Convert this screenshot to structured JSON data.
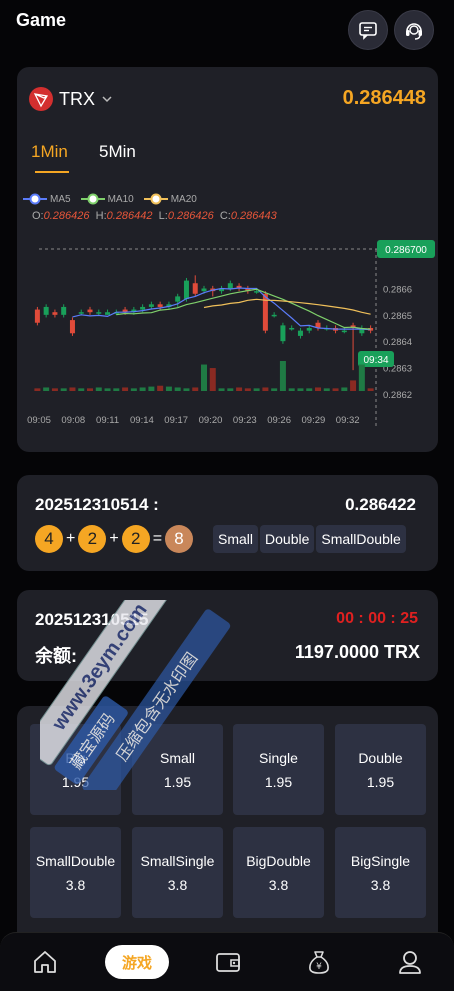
{
  "header": {
    "title": "Game",
    "icons": [
      "message-icon",
      "support-icon"
    ]
  },
  "chart_card": {
    "coin": "TRX",
    "price": "0.286448",
    "tabs": [
      "1Min",
      "5Min"
    ],
    "active_tab": "1Min",
    "legend": [
      "MA5",
      "MA10",
      "MA20"
    ],
    "legend_colors": [
      "#5b7cfa",
      "#7fd06b",
      "#f0c05a"
    ],
    "ohlc": {
      "o_label": "O:",
      "o": "0.286426",
      "h_label": "H:",
      "h": "0.286442",
      "l_label": "L:",
      "l": "0.286426",
      "c_label": "C:",
      "c": "0.286443"
    }
  },
  "chart_data": {
    "type": "candlestick",
    "x_ticks": [
      "09:05",
      "09:08",
      "09:11",
      "09:14",
      "09:17",
      "09:20",
      "09:23",
      "09:26",
      "09:29",
      "09:32"
    ],
    "y_ticks": [
      "0.2866",
      "0.2865",
      "0.2864",
      "0.2863",
      "0.2862"
    ],
    "ylim": [
      0.28615,
      0.28675
    ],
    "max_label": "0.286700",
    "cursor_time": "09:34",
    "candles": [
      {
        "o": 0.28652,
        "c": 0.28647,
        "h": 0.28653,
        "l": 0.28646
      },
      {
        "o": 0.2865,
        "c": 0.28653,
        "h": 0.28654,
        "l": 0.28649
      },
      {
        "o": 0.28651,
        "c": 0.2865,
        "h": 0.28652,
        "l": 0.28649
      },
      {
        "o": 0.2865,
        "c": 0.28653,
        "h": 0.28654,
        "l": 0.28649
      },
      {
        "o": 0.28648,
        "c": 0.28643,
        "h": 0.28649,
        "l": 0.28642
      },
      {
        "o": 0.28651,
        "c": 0.28651,
        "h": 0.28652,
        "l": 0.2865
      },
      {
        "o": 0.28652,
        "c": 0.28651,
        "h": 0.28653,
        "l": 0.2865
      },
      {
        "o": 0.28651,
        "c": 0.28651,
        "h": 0.28652,
        "l": 0.2865
      },
      {
        "o": 0.2865,
        "c": 0.28651,
        "h": 0.28652,
        "l": 0.2865
      },
      {
        "o": 0.28651,
        "c": 0.28651,
        "h": 0.28652,
        "l": 0.2865
      },
      {
        "o": 0.28652,
        "c": 0.28651,
        "h": 0.28653,
        "l": 0.2865
      },
      {
        "o": 0.28651,
        "c": 0.28652,
        "h": 0.28653,
        "l": 0.2865
      },
      {
        "o": 0.28652,
        "c": 0.28653,
        "h": 0.28654,
        "l": 0.28651
      },
      {
        "o": 0.28653,
        "c": 0.28654,
        "h": 0.28655,
        "l": 0.28652
      },
      {
        "o": 0.28654,
        "c": 0.28653,
        "h": 0.28655,
        "l": 0.28652
      },
      {
        "o": 0.28653,
        "c": 0.28654,
        "h": 0.28655,
        "l": 0.28652
      },
      {
        "o": 0.28655,
        "c": 0.28657,
        "h": 0.28658,
        "l": 0.28653
      },
      {
        "o": 0.28656,
        "c": 0.28663,
        "h": 0.28664,
        "l": 0.28655
      },
      {
        "o": 0.28662,
        "c": 0.28658,
        "h": 0.28665,
        "l": 0.28657
      },
      {
        "o": 0.28659,
        "c": 0.2866,
        "h": 0.28661,
        "l": 0.28658
      },
      {
        "o": 0.2866,
        "c": 0.28659,
        "h": 0.28661,
        "l": 0.28657
      },
      {
        "o": 0.28659,
        "c": 0.2866,
        "h": 0.28661,
        "l": 0.28658
      },
      {
        "o": 0.2866,
        "c": 0.28662,
        "h": 0.28663,
        "l": 0.28659
      },
      {
        "o": 0.28661,
        "c": 0.2866,
        "h": 0.28662,
        "l": 0.28659
      },
      {
        "o": 0.2866,
        "c": 0.28659,
        "h": 0.28661,
        "l": 0.28658
      },
      {
        "o": 0.28659,
        "c": 0.28659,
        "h": 0.2866,
        "l": 0.28658
      },
      {
        "o": 0.28658,
        "c": 0.28644,
        "h": 0.28659,
        "l": 0.28643
      },
      {
        "o": 0.2865,
        "c": 0.2865,
        "h": 0.28651,
        "l": 0.28649
      },
      {
        "o": 0.2864,
        "c": 0.28646,
        "h": 0.28647,
        "l": 0.28639
      },
      {
        "o": 0.28645,
        "c": 0.28645,
        "h": 0.28646,
        "l": 0.28644
      },
      {
        "o": 0.28642,
        "c": 0.28644,
        "h": 0.28645,
        "l": 0.28641
      },
      {
        "o": 0.28644,
        "c": 0.28645,
        "h": 0.28646,
        "l": 0.28643
      },
      {
        "o": 0.28647,
        "c": 0.28645,
        "h": 0.28648,
        "l": 0.28644
      },
      {
        "o": 0.28645,
        "c": 0.28645,
        "h": 0.28646,
        "l": 0.28644
      },
      {
        "o": 0.28645,
        "c": 0.28644,
        "h": 0.28646,
        "l": 0.28643
      },
      {
        "o": 0.28644,
        "c": 0.28644,
        "h": 0.28645,
        "l": 0.28643
      },
      {
        "o": 0.28646,
        "c": 0.28645,
        "h": 0.28647,
        "l": 0.28629
      },
      {
        "o": 0.28643,
        "c": 0.28645,
        "h": 0.28646,
        "l": 0.28642
      },
      {
        "o": 0.28645,
        "c": 0.28644,
        "h": 0.28646,
        "l": 0.28643
      }
    ],
    "volumes": [
      3,
      4,
      3,
      3,
      4,
      3,
      3,
      4,
      3,
      3,
      4,
      3,
      4,
      5,
      6,
      5,
      4,
      3,
      4,
      30,
      26,
      3,
      3,
      4,
      3,
      3,
      4,
      3,
      34,
      3,
      3,
      3,
      4,
      3,
      3,
      4,
      12,
      30,
      3
    ]
  },
  "result_card": {
    "issue": "202512310514 :",
    "price": "0.286422",
    "balls": [
      "4",
      "2",
      "2"
    ],
    "plus": "+",
    "equals": "=",
    "sum": "8",
    "tags": [
      "Small",
      "Double",
      "SmallDouble"
    ]
  },
  "countdown_card": {
    "issue": "202512310515",
    "countdown": "00 : 00 : 25",
    "balance_label": "余额:",
    "balance_value": "1197.0000 TRX"
  },
  "bet_options": [
    {
      "name": "Big",
      "odds": "1.95"
    },
    {
      "name": "Small",
      "odds": "1.95"
    },
    {
      "name": "Single",
      "odds": "1.95"
    },
    {
      "name": "Double",
      "odds": "1.95"
    },
    {
      "name": "SmallDouble",
      "odds": "3.8"
    },
    {
      "name": "SmallSingle",
      "odds": "3.8"
    },
    {
      "name": "BigDouble",
      "odds": "3.8"
    },
    {
      "name": "BigSingle",
      "odds": "3.8"
    }
  ],
  "watermark": {
    "lines": [
      "藏宝源码",
      "www.3eym.com",
      "压缩包含无水印图"
    ]
  },
  "nav": {
    "active_label": "游戏",
    "items": [
      "home-icon",
      "game",
      "wallet-icon",
      "money-bag-icon",
      "profile-icon"
    ]
  },
  "colors": {
    "accent": "#f5a623",
    "up": "#19a05a",
    "down": "#e04b3a",
    "card": "#1f2027",
    "countdown": "#e02020"
  }
}
